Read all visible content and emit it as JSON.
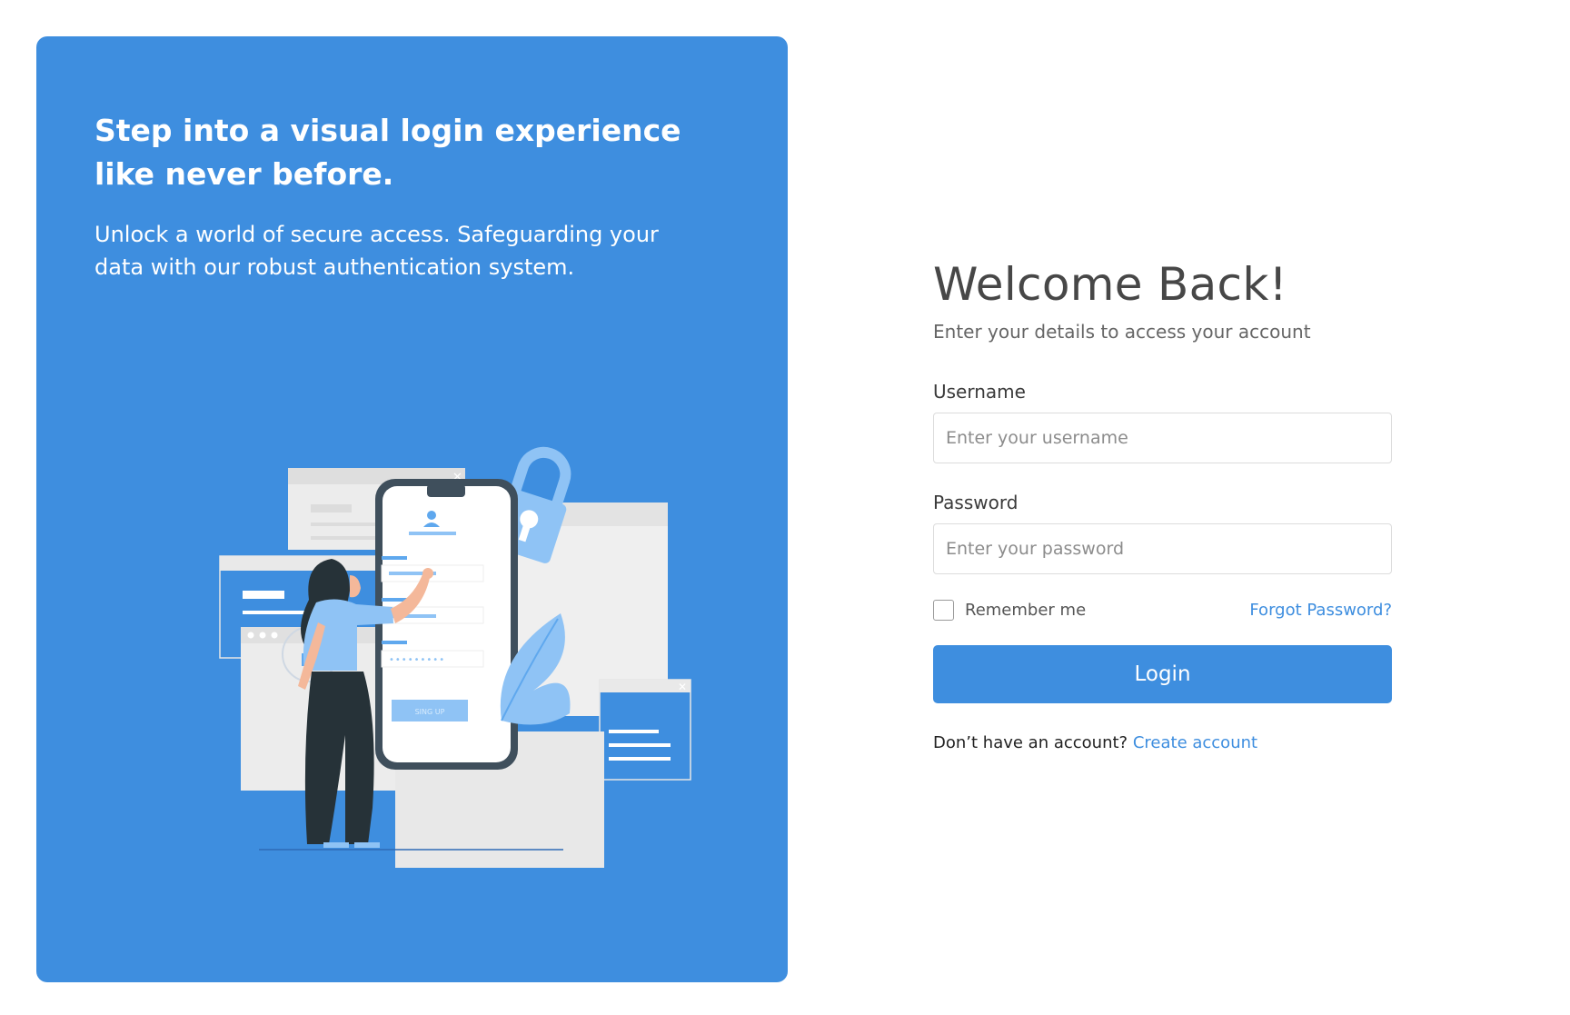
{
  "hero": {
    "title": "Step into a visual login experience like never before.",
    "subtitle": "Unlock a world of secure access. Safeguarding your data with our robust authentication system.",
    "illustration_button": "SING UP"
  },
  "login": {
    "heading": "Welcome Back!",
    "subheading": "Enter your details to access your account",
    "username_label": "Username",
    "username_placeholder": "Enter your username",
    "password_label": "Password",
    "password_placeholder": "Enter your password",
    "remember_label": "Remember me",
    "forgot_link": "Forgot Password?",
    "submit_label": "Login",
    "signup_prompt": "Don’t have an account?",
    "signup_link": "Create account"
  },
  "colors": {
    "accent": "#3e8edf",
    "heading": "#474747"
  }
}
